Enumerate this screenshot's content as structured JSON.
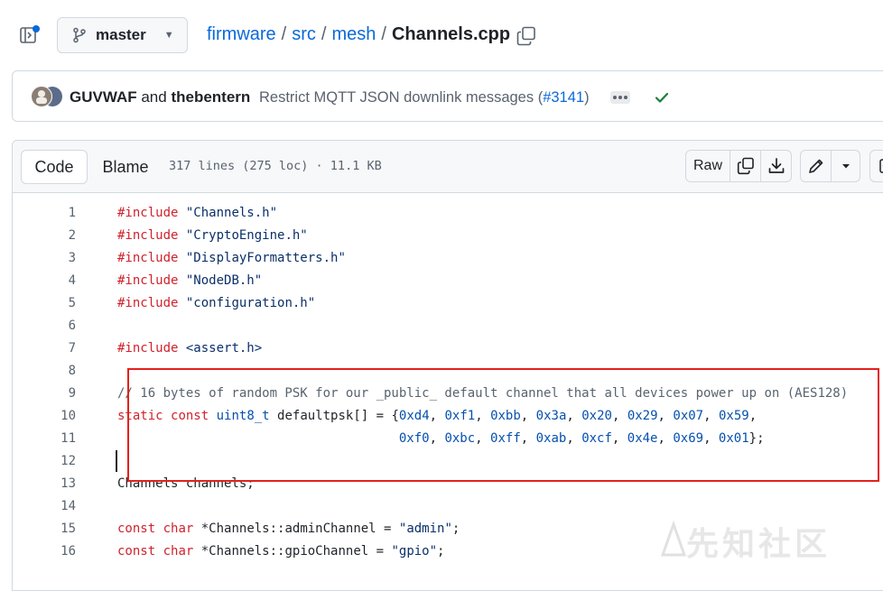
{
  "header": {
    "branch": "master",
    "breadcrumb": [
      "firmware",
      "src",
      "mesh"
    ],
    "separator": "/",
    "filename": "Channels.cpp"
  },
  "commit": {
    "author1": "GUVWAF",
    "and_text": "and",
    "author2": "thebentern",
    "message": "Restrict MQTT JSON downlink messages (",
    "pr": "#3141",
    "message_end": ")",
    "status": "success"
  },
  "file": {
    "tabs": [
      "Code",
      "Blame"
    ],
    "meta": "317 lines (275 loc) · 11.1 KB",
    "raw_label": "Raw",
    "icons": [
      "copy-icon",
      "download-icon",
      "pencil-icon",
      "chevron-down-icon",
      "symbols-icon"
    ]
  },
  "code_lines": [
    {
      "n": "1",
      "text": "#include \"Channels.h\""
    },
    {
      "n": "2",
      "text": "#include \"CryptoEngine.h\""
    },
    {
      "n": "3",
      "text": "#include \"DisplayFormatters.h\""
    },
    {
      "n": "4",
      "text": "#include \"NodeDB.h\""
    },
    {
      "n": "5",
      "text": "#include \"configuration.h\""
    },
    {
      "n": "6",
      "text": ""
    },
    {
      "n": "7",
      "text": "#include <assert.h>"
    },
    {
      "n": "8",
      "text": ""
    },
    {
      "n": "9",
      "text": "// 16 bytes of random PSK for our _public_ default channel that all devices power up on (AES128)"
    },
    {
      "n": "10",
      "text": "static const uint8_t defaultpsk[] = {0xd4, 0xf1, 0xbb, 0x3a, 0x20, 0x29, 0x07, 0x59,"
    },
    {
      "n": "11",
      "text": "                                     0xf0, 0xbc, 0xff, 0xab, 0xcf, 0x4e, 0x69, 0x01};"
    },
    {
      "n": "12",
      "text": ""
    },
    {
      "n": "13",
      "text": "Channels channels;"
    },
    {
      "n": "14",
      "text": ""
    },
    {
      "n": "15",
      "text": "const char *Channels::adminChannel = \"admin\";"
    },
    {
      "n": "16",
      "text": "const char *Channels::gpioChannel = \"gpio\";"
    }
  ],
  "watermark": "先知社区",
  "colors": {
    "link": "#0969da",
    "keyword": "#cf222e",
    "string": "#0a3069",
    "number": "#0550ae",
    "annotation": "#e3211c",
    "success": "#1a7f37"
  }
}
